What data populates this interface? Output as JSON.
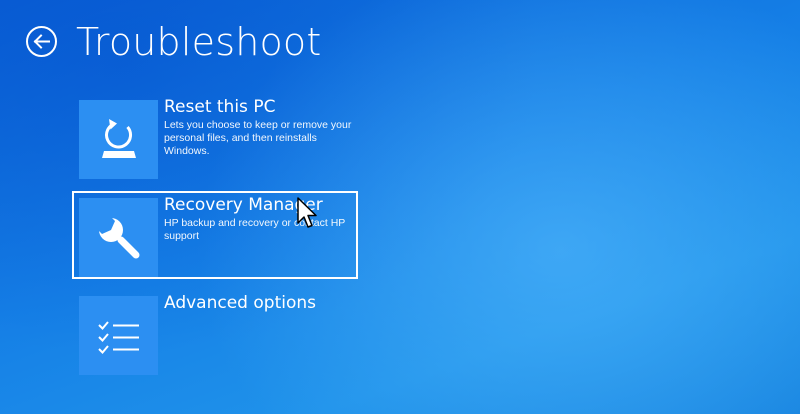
{
  "header": {
    "back_icon": "back-arrow-icon",
    "title": "Troubleshoot"
  },
  "options": [
    {
      "title": "Reset this PC",
      "description": "Lets you choose to keep or remove your personal files, and then reinstalls Windows.",
      "icon": "reset-pc-icon",
      "selected": false
    },
    {
      "title": "Recovery Manager",
      "description": "HP backup and recovery or contact HP support",
      "icon": "wrench-icon",
      "selected": true
    },
    {
      "title": "Advanced options",
      "description": "",
      "icon": "checklist-icon",
      "selected": false
    }
  ],
  "colors": {
    "background": "#1a7fe5",
    "tile": "#2c8ff2",
    "text": "#ffffff",
    "selection_border": "#ffffff"
  },
  "cursor": {
    "icon": "mouse-pointer-icon"
  }
}
